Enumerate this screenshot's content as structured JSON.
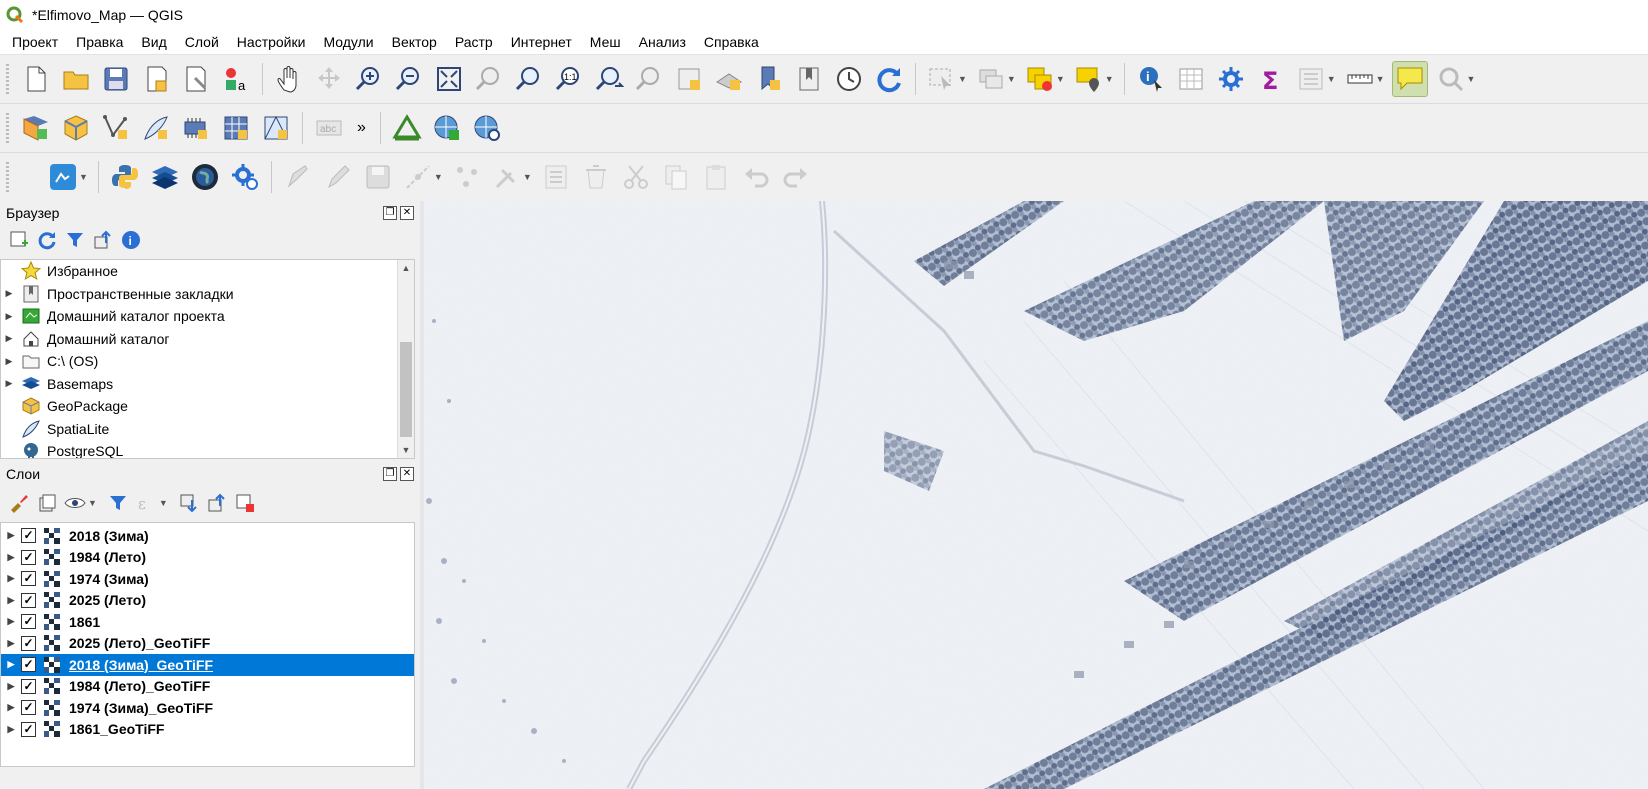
{
  "window": {
    "title": "*Elfimovo_Map — QGIS"
  },
  "menu": [
    "Проект",
    "Правка",
    "Вид",
    "Слой",
    "Настройки",
    "Модули",
    "Вектор",
    "Растр",
    "Интернет",
    "Меш",
    "Анализ",
    "Справка"
  ],
  "toolbar": {
    "label_tool": "abc",
    "overflow": "»",
    "row1_icons": [
      "new-project-icon",
      "open-project-icon",
      "save-project-icon",
      "print-layout-icon",
      "layout-manager-icon",
      "style-manager-icon",
      "pan-icon",
      "pan-to-selection-icon",
      "zoom-in-icon",
      "zoom-out-icon",
      "zoom-full-icon",
      "zoom-to-selection-icon",
      "zoom-to-layer-icon",
      "zoom-native-icon",
      "zoom-last-icon",
      "zoom-next-icon",
      "new-map-view-icon",
      "new-3d-view-icon",
      "new-bookmark-icon",
      "show-bookmarks-icon",
      "temporal-controller-icon",
      "refresh-icon",
      "select-features-icon",
      "deselect-icon",
      "select-by-expression-icon",
      "select-by-location-icon",
      "identify-icon",
      "open-attribute-table-icon",
      "toolbox-icon",
      "statistics-icon",
      "field-calculator-icon",
      "measure-icon",
      "map-tips-icon",
      "locator-icon"
    ],
    "row2_icons": [
      "data-source-manager-icon",
      "new-geopackage-layer-icon",
      "new-shapefile-layer-icon",
      "new-spatialite-layer-icon",
      "new-temporary-layer-icon",
      "new-virtual-layer-icon",
      "new-mesh-layer-icon",
      "label-tool-icon",
      "georeferencer-icon",
      "add-wms-layer-icon",
      "add-wfs-layer-icon"
    ],
    "row3_icons": [
      "plugin-icon",
      "python-console-icon",
      "qgis2web-icon",
      "globe-icon",
      "processing-settings-icon",
      "digitize-icon",
      "edit-pencil-icon",
      "save-edits-icon",
      "add-vertex-icon",
      "vertex-tool-icon",
      "edit-attributes-icon",
      "delete-selected-icon",
      "cut-icon",
      "copy-icon",
      "paste-icon",
      "undo-icon",
      "redo-icon"
    ]
  },
  "browser_panel": {
    "title": "Браузер",
    "items": [
      {
        "label": "Избранное",
        "icon": "star-icon",
        "expandable": false
      },
      {
        "label": "Пространственные закладки",
        "icon": "bookmark-icon",
        "expandable": true
      },
      {
        "label": "Домашний каталог проекта",
        "icon": "project-home-icon",
        "expandable": true
      },
      {
        "label": "Домашний каталог",
        "icon": "home-icon",
        "expandable": true
      },
      {
        "label": "C:\\ (OS)",
        "icon": "folder-icon",
        "expandable": true
      },
      {
        "label": "Basemaps",
        "icon": "basemaps-icon",
        "expandable": true
      },
      {
        "label": "GeoPackage",
        "icon": "geopackage-icon",
        "expandable": false
      },
      {
        "label": "SpatiaLite",
        "icon": "spatialite-icon",
        "expandable": false
      },
      {
        "label": "PostgreSQL",
        "icon": "postgresql-icon",
        "expandable": false
      }
    ]
  },
  "layers_panel": {
    "title": "Слои",
    "layers": [
      {
        "name": "2018 (Зима)",
        "checked": true,
        "selected": false
      },
      {
        "name": "1984 (Лето)",
        "checked": true,
        "selected": false
      },
      {
        "name": "1974 (Зима)",
        "checked": true,
        "selected": false
      },
      {
        "name": "2025 (Лето)",
        "checked": true,
        "selected": false
      },
      {
        "name": "1861",
        "checked": true,
        "selected": false
      },
      {
        "name": "2025 (Лето)_GeoTiFF",
        "checked": true,
        "selected": false
      },
      {
        "name": "2018 (Зима)_GeoTiFF",
        "checked": true,
        "selected": true
      },
      {
        "name": "1984 (Лето)_GeoTiFF",
        "checked": true,
        "selected": false
      },
      {
        "name": "1974 (Зима)_GeoTiFF",
        "checked": true,
        "selected": false
      },
      {
        "name": "1861_GeoTiFF",
        "checked": true,
        "selected": false
      }
    ]
  },
  "colors": {
    "selection": "#0078d7",
    "map_snow": "#f4f6f9",
    "trees": "#5a6a8a"
  }
}
